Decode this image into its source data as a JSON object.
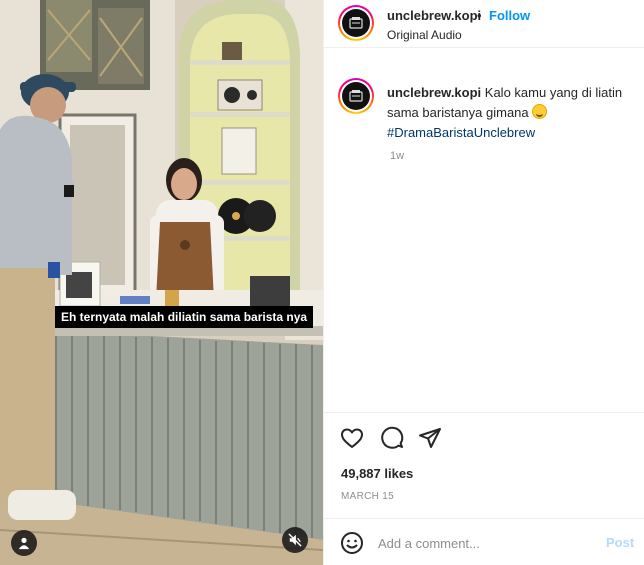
{
  "header": {
    "username": "unclebrew.kopi",
    "separator": "•",
    "follow_label": "Follow",
    "audio_label": "Original Audio",
    "avatar_icon": "unclebrew-logo-icon"
  },
  "comment": {
    "username": "unclebrew.kopi",
    "text": "Kalo kamu yang di liatin sama baristanya gimana",
    "emoji": "rolling-on-floor-laughing-emoji",
    "hashtag": "#DramaBaristaUnclebrew",
    "time": "1w"
  },
  "media": {
    "subtitle": "Eh ternyata malah diliatin sama barista nya",
    "profile_icon": "user-icon",
    "mute_icon": "muted-speaker-icon"
  },
  "actions": {
    "like_icon": "heart-icon",
    "comment_icon": "comment-bubble-icon",
    "share_icon": "paper-plane-icon",
    "likes": "49,887 likes",
    "date": "MARCH 15"
  },
  "add_comment": {
    "placeholder": "Add a comment...",
    "post_label": "Post",
    "emoji_icon": "smiley-icon"
  },
  "colors": {
    "follow_blue": "#0095f6",
    "hashtag_blue": "#00376b",
    "post_disabled": "#b3dbff",
    "muted_text": "#8e8e8e"
  }
}
